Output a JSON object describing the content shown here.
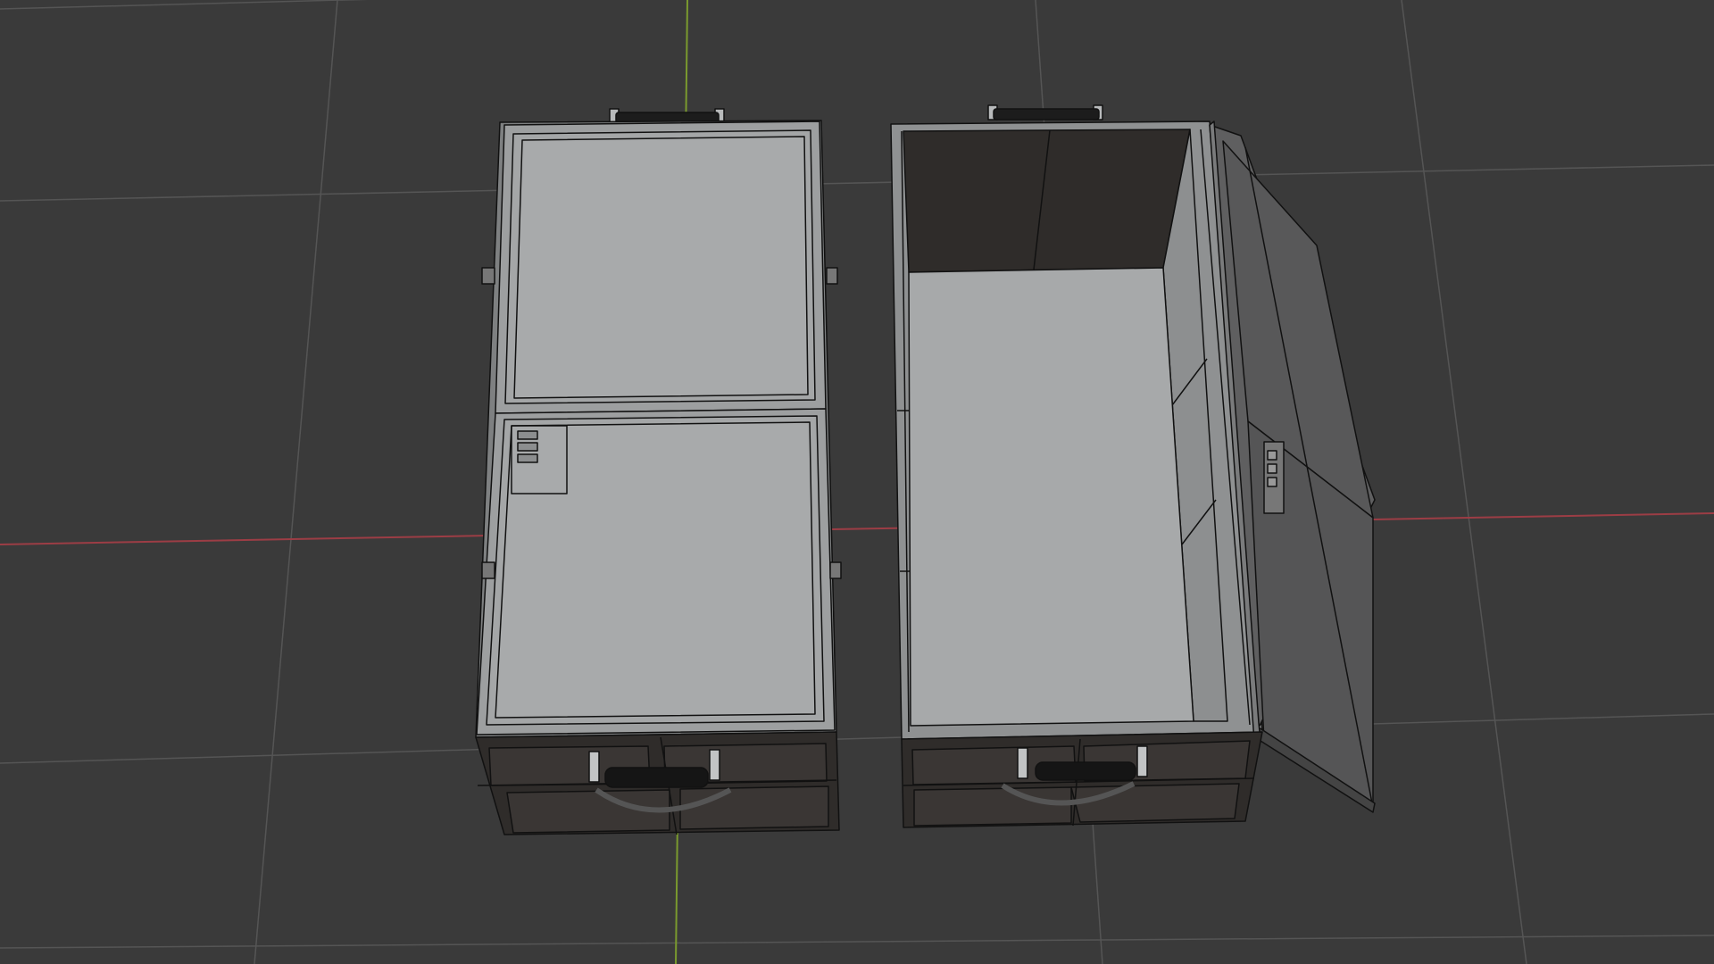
{
  "viewport": {
    "view": "top-orthographic",
    "shading": "solid",
    "overlay": "wireframe"
  },
  "colors": {
    "background": "#3a3a3a",
    "grid": "#555555",
    "x_axis": "#9c3d45",
    "y_axis": "#7a9a2e",
    "surface_light": "#a6a8a9",
    "surface_mid": "#8f9192",
    "surface_dark": "#2f2c2a",
    "wire": "#111111"
  },
  "objects": [
    {
      "name": "crate-closed",
      "state": "closed"
    },
    {
      "name": "crate-open",
      "state": "open"
    }
  ]
}
